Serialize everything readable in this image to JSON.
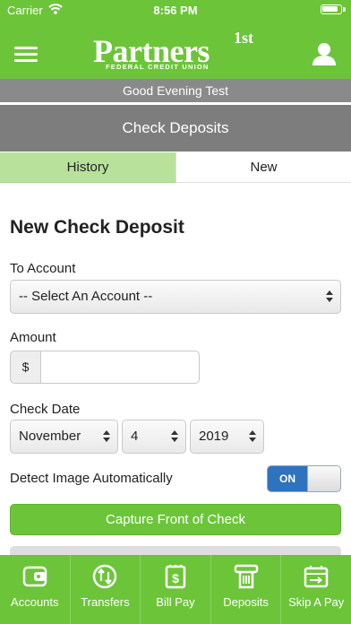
{
  "status_bar": {
    "carrier": "Carrier",
    "time": "8:56 PM"
  },
  "header": {
    "logo_text": "Partners",
    "logo_superscript": "1st",
    "logo_subtitle": "FEDERAL CREDIT UNION",
    "menu_icon": "hamburger-menu-icon",
    "profile_icon": "user-icon"
  },
  "greeting": "Good Evening Test",
  "page_title": "Check Deposits",
  "tabs": [
    {
      "label": "History",
      "active": false
    },
    {
      "label": "New",
      "active": true
    }
  ],
  "form": {
    "heading": "New Check Deposit",
    "to_account": {
      "label": "To Account",
      "selected": "-- Select An Account --"
    },
    "amount": {
      "label": "Amount",
      "prefix": "$",
      "value": ""
    },
    "check_date": {
      "label": "Check Date",
      "month": "November",
      "day": "4",
      "year": "2019"
    },
    "detect_image": {
      "label": "Detect Image Automatically",
      "state": "ON"
    },
    "capture_button": "Capture Front of Check"
  },
  "bottom_nav": [
    {
      "label": "Accounts",
      "icon": "wallet-icon"
    },
    {
      "label": "Transfers",
      "icon": "transfer-arrows-icon"
    },
    {
      "label": "Bill Pay",
      "icon": "bill-pay-icon"
    },
    {
      "label": "Deposits",
      "icon": "check-deposit-icon"
    },
    {
      "label": "Skip A Pay",
      "icon": "skip-a-pay-icon"
    }
  ],
  "colors": {
    "brand_green": "#6cc539",
    "tab_history_bg": "#b8e29c",
    "title_bar_gray": "#7d7d7d",
    "greeting_gray": "#8a8a8a",
    "toggle_on_blue": "#2e73bd"
  }
}
